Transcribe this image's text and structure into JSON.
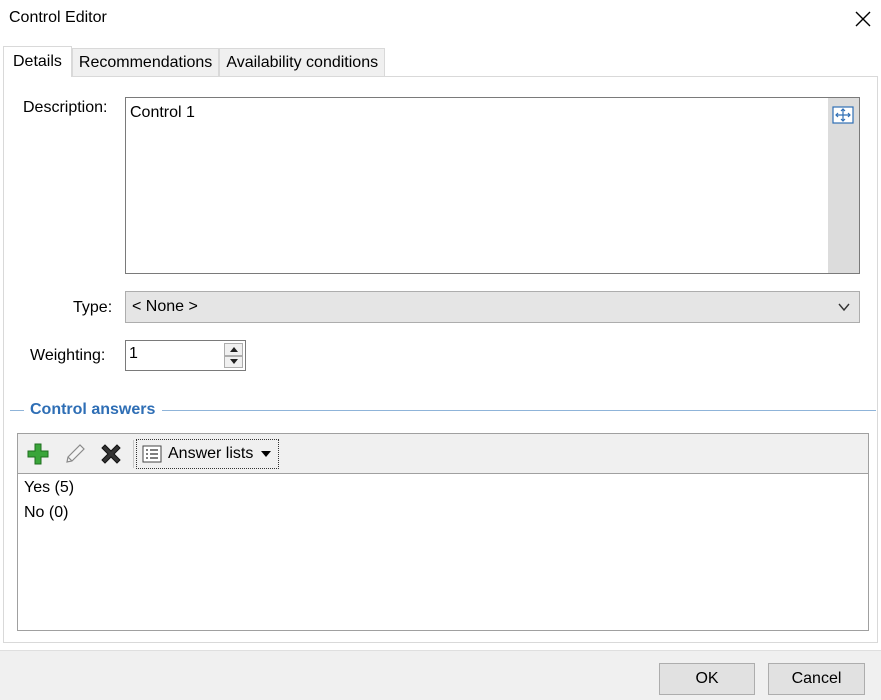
{
  "window": {
    "title": "Control Editor",
    "close_icon": "close-icon"
  },
  "tabs": [
    {
      "label": "Details",
      "active": true
    },
    {
      "label": "Recommendations",
      "active": false
    },
    {
      "label": "Availability conditions",
      "active": false
    }
  ],
  "details": {
    "description_label": "Description:",
    "description_value": "Control 1",
    "type_label": "Type:",
    "type_value": "< None >",
    "weighting_label": "Weighting:",
    "weighting_value": "1"
  },
  "control_answers": {
    "title": "Control answers",
    "toolbar": {
      "add_icon": "plus-icon",
      "edit_icon": "pencil-icon",
      "delete_icon": "delete-icon",
      "answer_lists_label": "Answer lists"
    },
    "items": [
      {
        "label": "Yes (5)"
      },
      {
        "label": "No (0)"
      }
    ]
  },
  "footer": {
    "ok_label": "OK",
    "cancel_label": "Cancel"
  },
  "colors": {
    "accent": "#2e6eb5",
    "add_green": "#2e9b2e",
    "panel_bg": "#f0f0f0"
  }
}
